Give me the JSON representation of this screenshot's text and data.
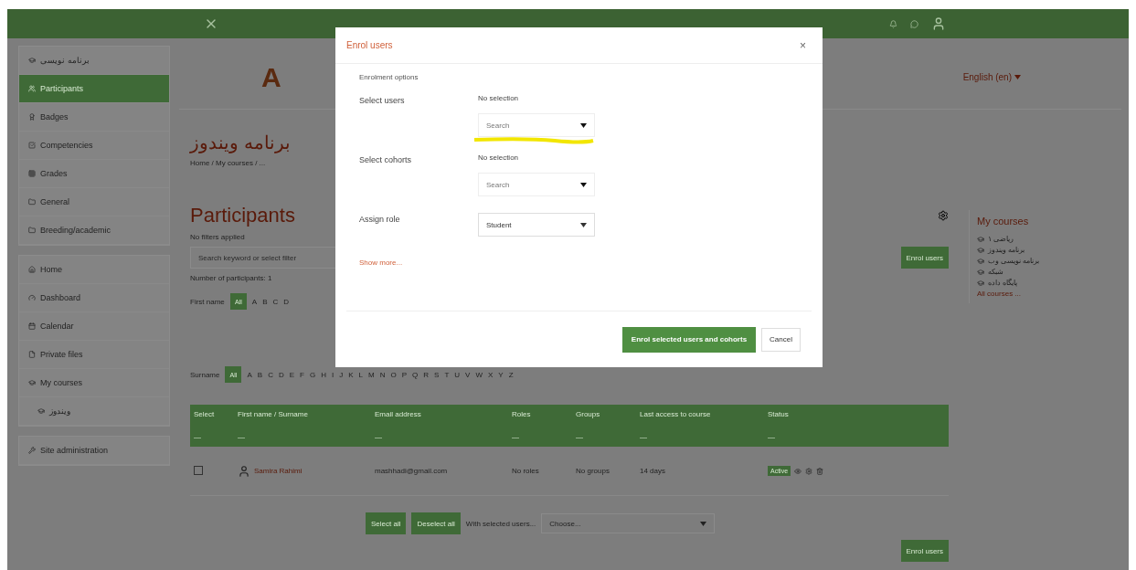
{
  "sidebar": {
    "sections": [
      {
        "items": [
          {
            "label": "برنامه نویسی",
            "selected": false
          },
          {
            "label": "Participants",
            "selected": true
          },
          {
            "label": "Badges",
            "selected": false
          },
          {
            "label": "Competencies",
            "selected": false
          },
          {
            "label": "Grades",
            "selected": false
          },
          {
            "label": "General",
            "selected": false
          },
          {
            "label": "Breeding/academic",
            "selected": false
          }
        ]
      },
      {
        "items": [
          {
            "label": "Home",
            "selected": false
          },
          {
            "label": "Dashboard",
            "selected": false
          },
          {
            "label": "Calendar",
            "selected": false
          },
          {
            "label": "Private files",
            "selected": false
          },
          {
            "label": "My courses",
            "selected": false
          },
          {
            "label": "ویندوز",
            "selected": false,
            "kind": "sub"
          }
        ]
      },
      {
        "items": [
          {
            "label": "Site administration",
            "selected": false
          }
        ]
      }
    ]
  },
  "header": {
    "logo_letter": "A",
    "language": "English (en)"
  },
  "course": {
    "title": "برنامه ویندوز",
    "breadcrumb": "Home / My courses / ..."
  },
  "participants": {
    "title": "Participants",
    "filters": "No filters applied",
    "search_placeholder": "Search keyword or select filter",
    "count": "Number of participants: 1",
    "first_name": {
      "label": "First name",
      "all": "All",
      "letters": [
        "A",
        "B",
        "C",
        "D"
      ]
    },
    "surname": {
      "label": "Surname",
      "all": "All",
      "letters": [
        "A",
        "B",
        "C",
        "D",
        "E",
        "F",
        "G",
        "H",
        "I",
        "J",
        "K",
        "L",
        "M",
        "N",
        "O",
        "P",
        "Q",
        "R",
        "S",
        "T",
        "U",
        "V",
        "W",
        "X",
        "Y",
        "Z"
      ]
    },
    "columns": [
      {
        "label": "Select",
        "sub": "—"
      },
      {
        "label": "First name / Surname",
        "sub": "—"
      },
      {
        "label": "Email address",
        "sub": "—"
      },
      {
        "label": "Roles",
        "sub": "—"
      },
      {
        "label": "Groups",
        "sub": "—"
      },
      {
        "label": "Last access to course",
        "sub": "—"
      },
      {
        "label": "Status",
        "sub": "—"
      }
    ],
    "rows": [
      {
        "checked": false,
        "name": "Samira Rahimi",
        "email": "mashhadi@gmail.com",
        "roles": "No roles",
        "groups": "No groups",
        "last_access": "14 days",
        "status": "Active"
      }
    ],
    "select_all": "Select all",
    "deselect_all": "Deselect all",
    "with_selected": "With selected users...",
    "choose": "Choose...",
    "enrol_button": "Enrol users"
  },
  "right": {
    "enrol_button": "Enrol users",
    "block_title": "My courses",
    "courses": [
      "ریاضی ۱",
      "برنامه ویندوز",
      "برنامه نویسی وب",
      "شبکه",
      "پایگاه داده"
    ],
    "all_courses": "All courses ..."
  },
  "modal": {
    "title": "Enrol users",
    "close": "×",
    "section": "Enrolment options",
    "fields": [
      {
        "label": "Select users",
        "selection": "No selection",
        "placeholder": "Search",
        "highlighted": true
      },
      {
        "label": "Select cohorts",
        "selection": "No selection",
        "placeholder": "Search",
        "highlighted": false
      }
    ],
    "role_label": "Assign role",
    "role": "Student",
    "show_more": "Show more...",
    "primary": "Enrol selected users and cohorts",
    "cancel": "Cancel"
  }
}
